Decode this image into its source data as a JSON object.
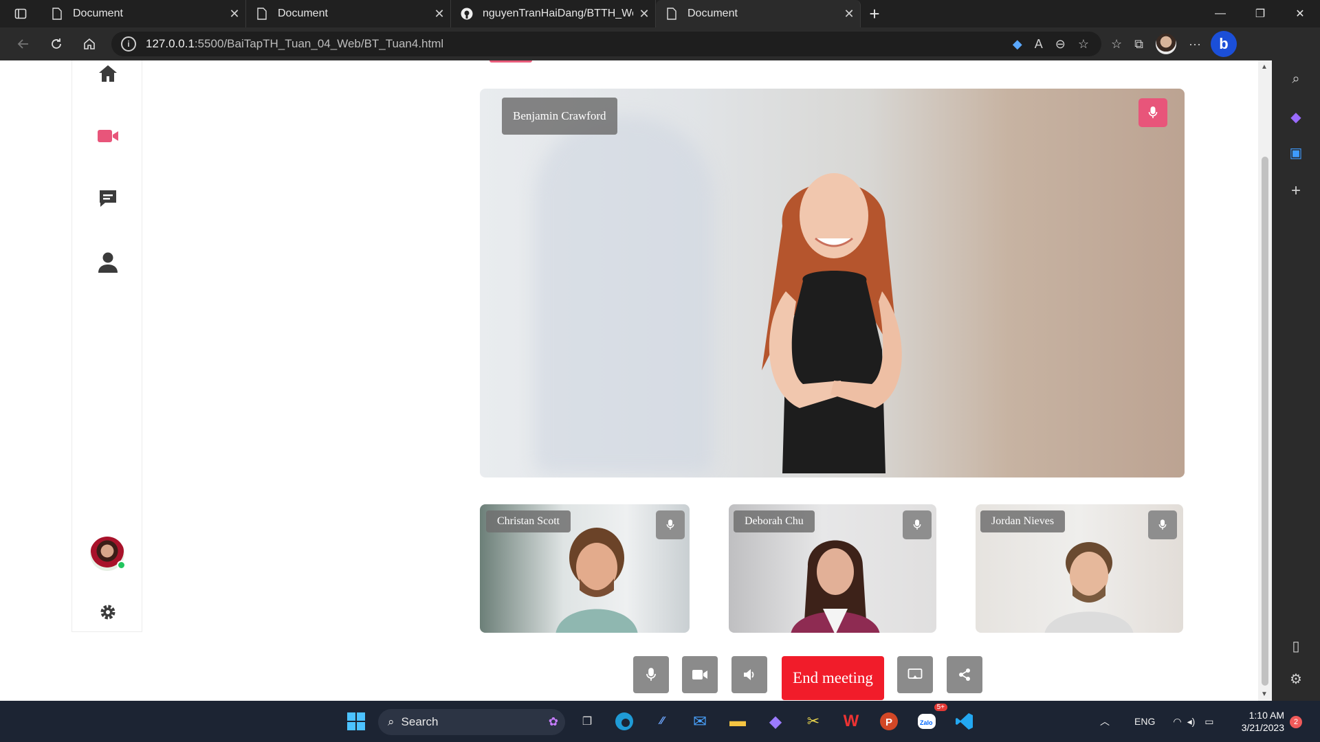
{
  "browser": {
    "tabs": [
      {
        "title": "Document",
        "icon": "document-icon",
        "active": false
      },
      {
        "title": "Document",
        "icon": "document-icon",
        "active": false
      },
      {
        "title": "nguyenTranHaiDang/BTTH_Web",
        "icon": "github-icon",
        "active": false
      },
      {
        "title": "Document",
        "icon": "document-icon",
        "active": true
      }
    ],
    "url_host": "127.0.0.1",
    "url_rest": ":5500/BaiTapTH_Tuan_04_Web/BT_Tuan4.html"
  },
  "sidebar": {
    "items": [
      "home-icon",
      "video-icon",
      "chat-icon",
      "user-icon"
    ],
    "active_color": "#e8557a",
    "settings": "gear-icon"
  },
  "main_video": {
    "participant": "Benjamin Crawford",
    "mic_color": "#e8557a"
  },
  "participants": [
    {
      "name": "Christan Scott"
    },
    {
      "name": "Deborah Chu"
    },
    {
      "name": "Jordan Nieves"
    }
  ],
  "controls": {
    "end_meeting": "End meeting",
    "end_color": "#f11c2a",
    "button_color": "#8b8b8b"
  },
  "taskbar": {
    "search_label": "Search",
    "language": "ENG",
    "time": "1:10 AM",
    "date": "3/21/2023",
    "notification_count": "2",
    "zalo_badge": "5+"
  }
}
